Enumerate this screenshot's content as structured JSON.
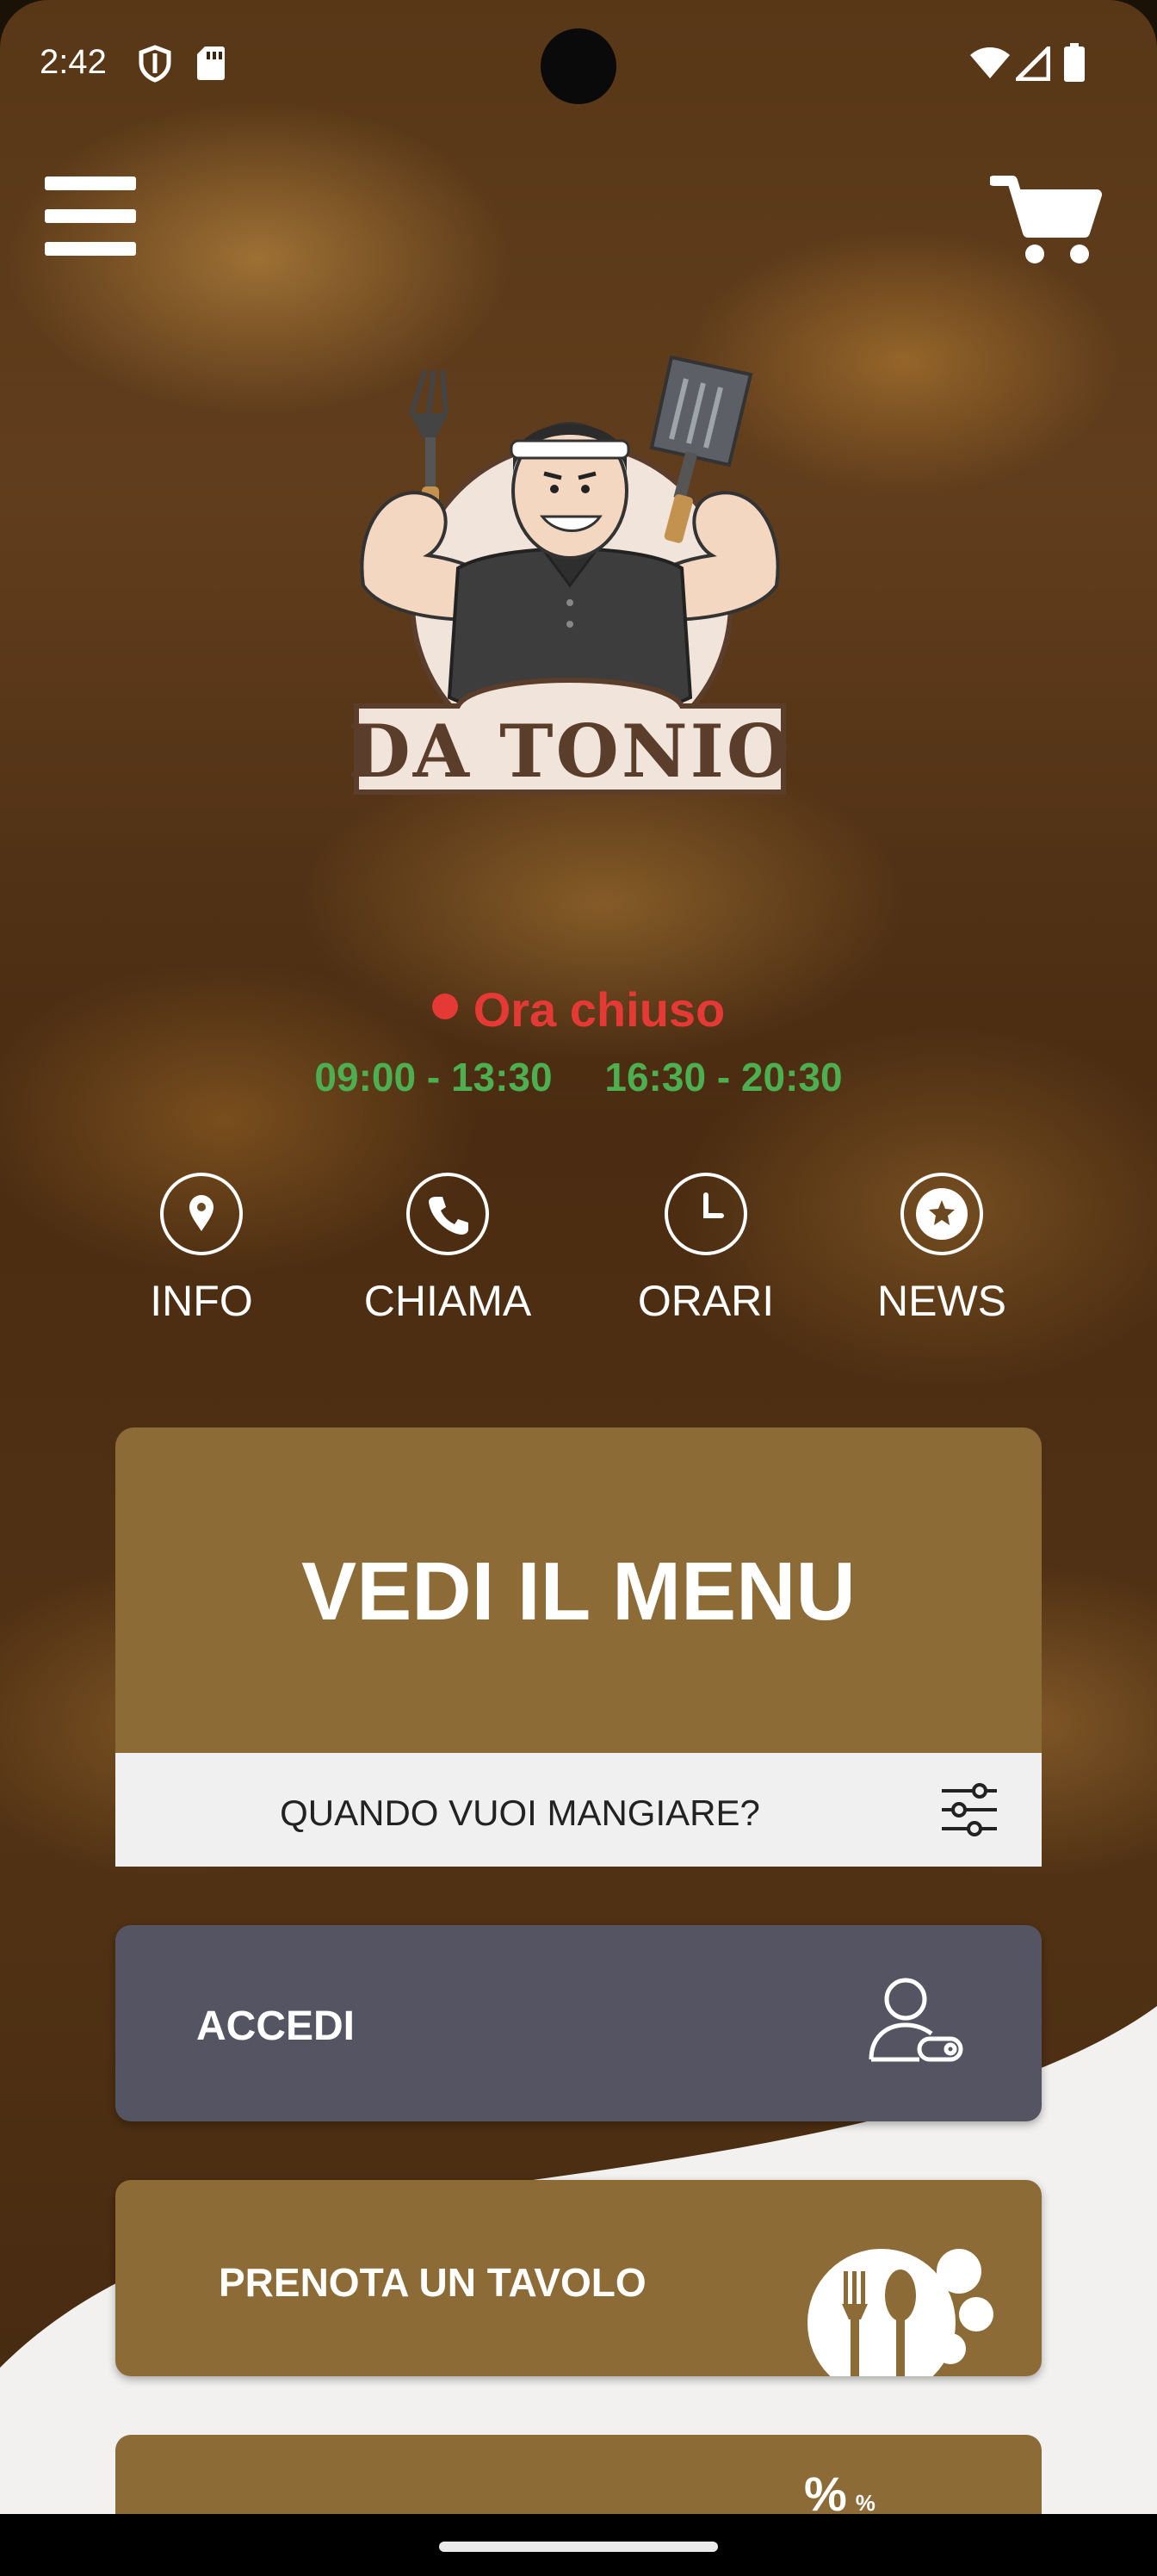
{
  "status_bar": {
    "time": "2:42"
  },
  "header": {
    "menu_icon": "hamburger-menu-icon",
    "cart_icon": "shopping-cart-icon"
  },
  "brand": {
    "name": "DA TONIO"
  },
  "open_status": {
    "label": "Ora chiuso",
    "color": "#e53935"
  },
  "hours": {
    "morning": "09:00 - 13:30",
    "evening": "16:30 - 20:30",
    "color": "#4caf50"
  },
  "quick_actions": [
    {
      "label": "INFO",
      "icon": "location-pin-icon"
    },
    {
      "label": "CHIAMA",
      "icon": "phone-icon"
    },
    {
      "label": "ORARI",
      "icon": "clock-icon"
    },
    {
      "label": "NEWS",
      "icon": "star-chat-icon"
    }
  ],
  "menu_card": {
    "title": "VEDI IL MENU",
    "when_label": "QUANDO VUOI MANGIARE?"
  },
  "accedi": {
    "label": "ACCEDI"
  },
  "prenota": {
    "label": "PRENOTA UN TAVOLO"
  },
  "promo": {
    "symbol": "%",
    "symbol_small": "%"
  },
  "colors": {
    "brand_brown": "#8c6b36",
    "login_gray": "#555463"
  }
}
